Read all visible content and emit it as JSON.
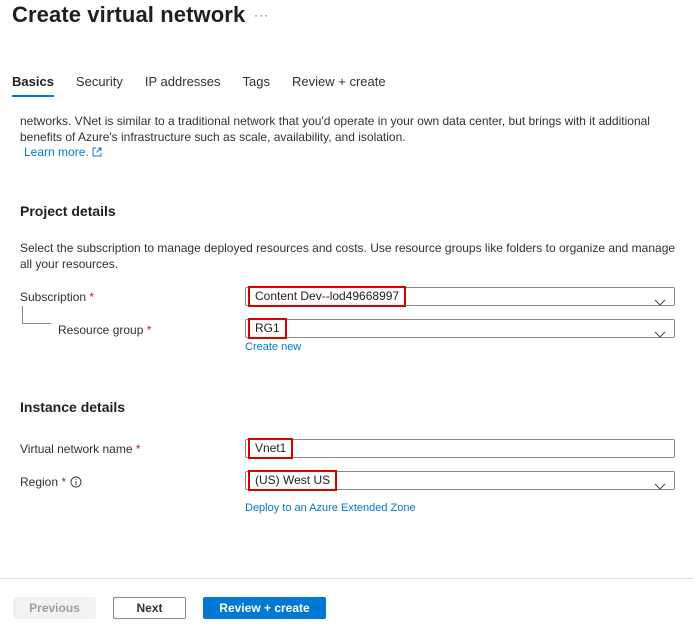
{
  "header": {
    "title": "Create virtual network",
    "more_label": "···"
  },
  "tabs": [
    {
      "label": "Basics",
      "active": true
    },
    {
      "label": "Security",
      "active": false
    },
    {
      "label": "IP addresses",
      "active": false
    },
    {
      "label": "Tags",
      "active": false
    },
    {
      "label": "Review + create",
      "active": false
    }
  ],
  "intro": {
    "text": "networks. VNet is similar to a traditional network that you'd operate in your own data center, but brings with it additional benefits of Azure's infrastructure such as scale, availability, and isolation.",
    "learn_more": "Learn more."
  },
  "project_details": {
    "title": "Project details",
    "description": "Select the subscription to manage deployed resources and costs. Use resource groups like folders to organize and manage all your resources.",
    "subscription": {
      "label": "Subscription",
      "required": "*",
      "value": "Content Dev--lod49668997"
    },
    "resource_group": {
      "label": "Resource group",
      "required": "*",
      "value": "RG1",
      "create_new": "Create new"
    }
  },
  "instance_details": {
    "title": "Instance details",
    "vnet_name": {
      "label": "Virtual network name",
      "required": "*",
      "value": "Vnet1"
    },
    "region": {
      "label": "Region",
      "required": "*",
      "value": "(US) West US",
      "extended_zone_link": "Deploy to an Azure Extended Zone"
    }
  },
  "footer": {
    "previous": "Previous",
    "next": "Next",
    "review_create": "Review + create"
  },
  "colors": {
    "accent": "#0078d4",
    "highlight": "#d80000",
    "required": "#a4262c"
  },
  "icons": {
    "external": "external-link-icon",
    "info": "info-icon",
    "chevron": "chevron-down-icon"
  }
}
